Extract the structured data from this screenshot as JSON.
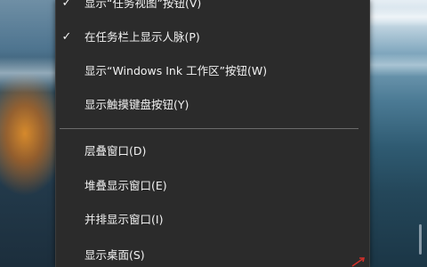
{
  "menu": {
    "items": [
      {
        "label": "显示“任务视图”按钮(V)",
        "checked": true
      },
      {
        "label": "在任务栏上显示人脉(P)",
        "checked": true
      },
      {
        "label": "显示“Windows Ink 工作区”按钮(W)",
        "checked": false
      },
      {
        "label": "显示触摸键盘按钮(Y)",
        "checked": false
      },
      {
        "label": "层叠窗口(D)",
        "checked": false
      },
      {
        "label": "堆叠显示窗口(E)",
        "checked": false
      },
      {
        "label": "并排显示窗口(I)",
        "checked": false
      },
      {
        "label": "显示桌面(S)",
        "checked": false
      }
    ],
    "check_glyph": "✓"
  },
  "colors": {
    "menu_bg": "#2b2b2b",
    "menu_text": "#f2f2f2",
    "separator": "#6b6b6b",
    "pointer": "#d0302a"
  }
}
